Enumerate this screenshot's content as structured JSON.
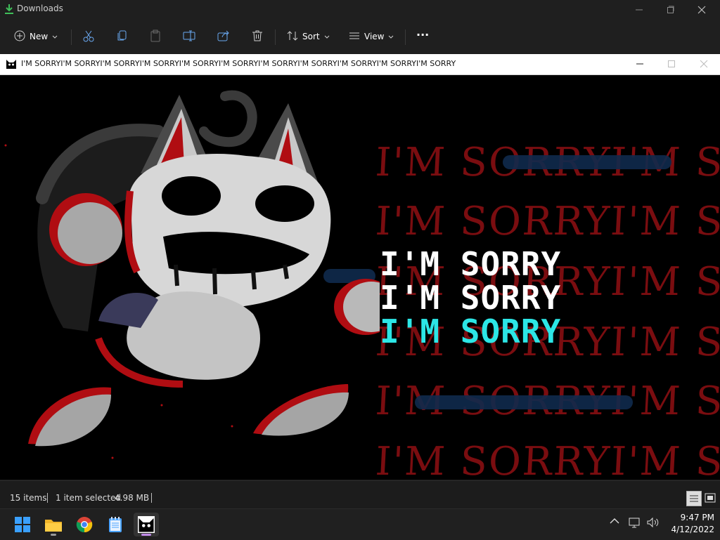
{
  "explorer": {
    "title": "Downloads",
    "toolbar": {
      "new_label": "New",
      "sort_label": "Sort",
      "view_label": "View",
      "more_label": "···"
    },
    "status": {
      "items": "15 items",
      "selected": "1 item selected",
      "size": "4.98 MB"
    }
  },
  "app_window": {
    "title": "I'M SORRYI'M SORRYI'M SORRYI'M SORRYI'M SORRYI'M SORRYI'M SORRYI'M SORRYI'M SORRYI'M SORRYI'M SORRY"
  },
  "canvas": {
    "bg_lines": [
      "I'M SORRYI'M SORRY",
      "I'M SORRYI'M SORRY",
      "I'M SORRYI'M SORRY",
      "I'M SORRYI'M SORRY",
      "I'M SORRYI'M SORRY",
      "I'M SORRYI'M SORRY"
    ],
    "fg_lines": [
      "I'M SORRY",
      "I'M SORRY",
      "I'M SORRY"
    ]
  },
  "taskbar": {
    "clock_time": "9:47 PM",
    "clock_date": "4/12/2022"
  },
  "colors": {
    "accent_cyan": "#2ce6e6",
    "bg_red": "#7a0d10",
    "taskbar": "#202020"
  }
}
